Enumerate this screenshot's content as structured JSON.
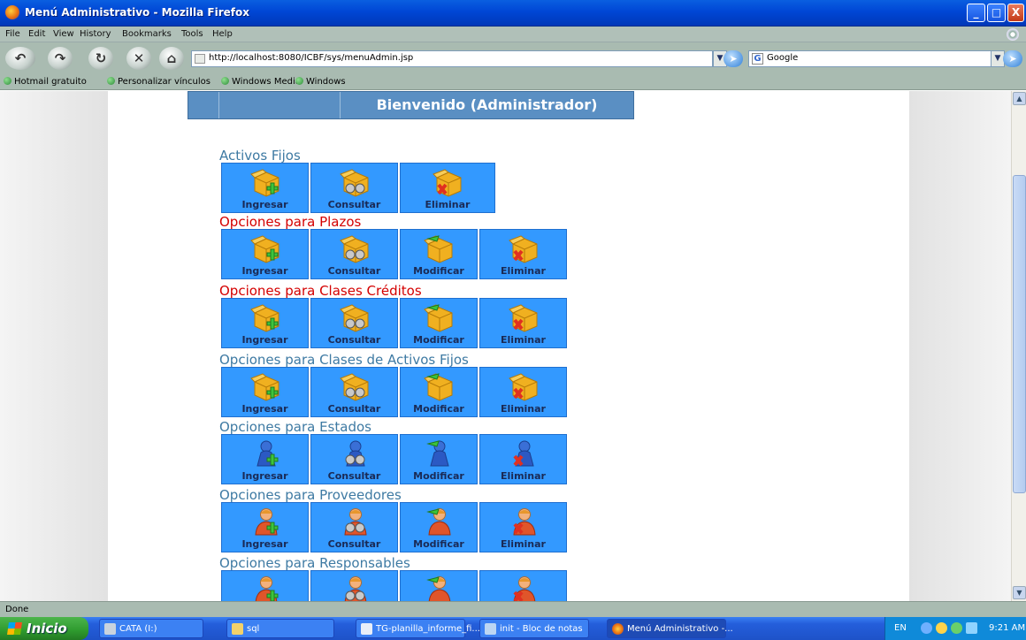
{
  "window": {
    "title": "Menú Administrativo - Mozilla Firefox",
    "controls": {
      "minimize": "_",
      "maximize": "□",
      "close": "X"
    }
  },
  "menubar": {
    "items": [
      "File",
      "Edit",
      "View",
      "History",
      "Bookmarks",
      "Tools",
      "Help"
    ]
  },
  "navigation": {
    "url": "http://localhost:8080/ICBF/sys/menuAdmin.jsp",
    "search_engine": "Google",
    "icons": [
      "back-icon",
      "forward-icon",
      "reload-icon",
      "stop-icon",
      "home-icon"
    ]
  },
  "bookmarks": {
    "items": [
      "Hotmail gratuito",
      "Personalizar vínculos",
      "Windows Media",
      "Windows"
    ]
  },
  "page": {
    "welcome": "Bienvenido (Administrador)",
    "sections": [
      {
        "title": "Activos Fijos",
        "color": "#3e7aa3",
        "icon_type": "box",
        "buttons": [
          "Ingresar",
          "Consultar",
          "Eliminar"
        ]
      },
      {
        "title": "Opciones para Plazos",
        "color": "#d40000",
        "icon_type": "box",
        "buttons": [
          "Ingresar",
          "Consultar",
          "Modificar",
          "Eliminar"
        ]
      },
      {
        "title": "Opciones para Clases Créditos",
        "color": "#d40000",
        "icon_type": "box",
        "buttons": [
          "Ingresar",
          "Consultar",
          "Modificar",
          "Eliminar"
        ]
      },
      {
        "title": "Opciones para Clases de Activos Fijos",
        "color": "#3e7aa3",
        "icon_type": "box",
        "buttons": [
          "Ingresar",
          "Consultar",
          "Modificar",
          "Eliminar"
        ]
      },
      {
        "title": "Opciones para Estados",
        "color": "#3e7aa3",
        "icon_type": "pawn",
        "buttons": [
          "Ingresar",
          "Consultar",
          "Modificar",
          "Eliminar"
        ]
      },
      {
        "title": "Opciones para Proveedores",
        "color": "#3e7aa3",
        "icon_type": "user",
        "buttons": [
          "Ingresar",
          "Consultar",
          "Modificar",
          "Eliminar"
        ]
      },
      {
        "title": "Opciones para Responsables",
        "color": "#3e7aa3",
        "icon_type": "user",
        "buttons": [
          "Ingresar",
          "Consultar",
          "Modificar",
          "Eliminar"
        ]
      }
    ],
    "tile_color": "#3399ff"
  },
  "statusbar": {
    "text": "Done"
  },
  "taskbar": {
    "start_label": "Inicio",
    "tasks": [
      {
        "label": "CATA (I:)",
        "icon": "drive-icon"
      },
      {
        "label": "sql",
        "icon": "folder-icon"
      },
      {
        "label": "TG-planilla_informe_fi...",
        "icon": "document-icon"
      },
      {
        "label": "init - Bloc de notas",
        "icon": "notepad-icon"
      },
      {
        "label": "Menú Administrativo -...",
        "icon": "firefox-icon"
      }
    ],
    "tray": {
      "language": "EN",
      "time": "9:21 AM"
    }
  }
}
